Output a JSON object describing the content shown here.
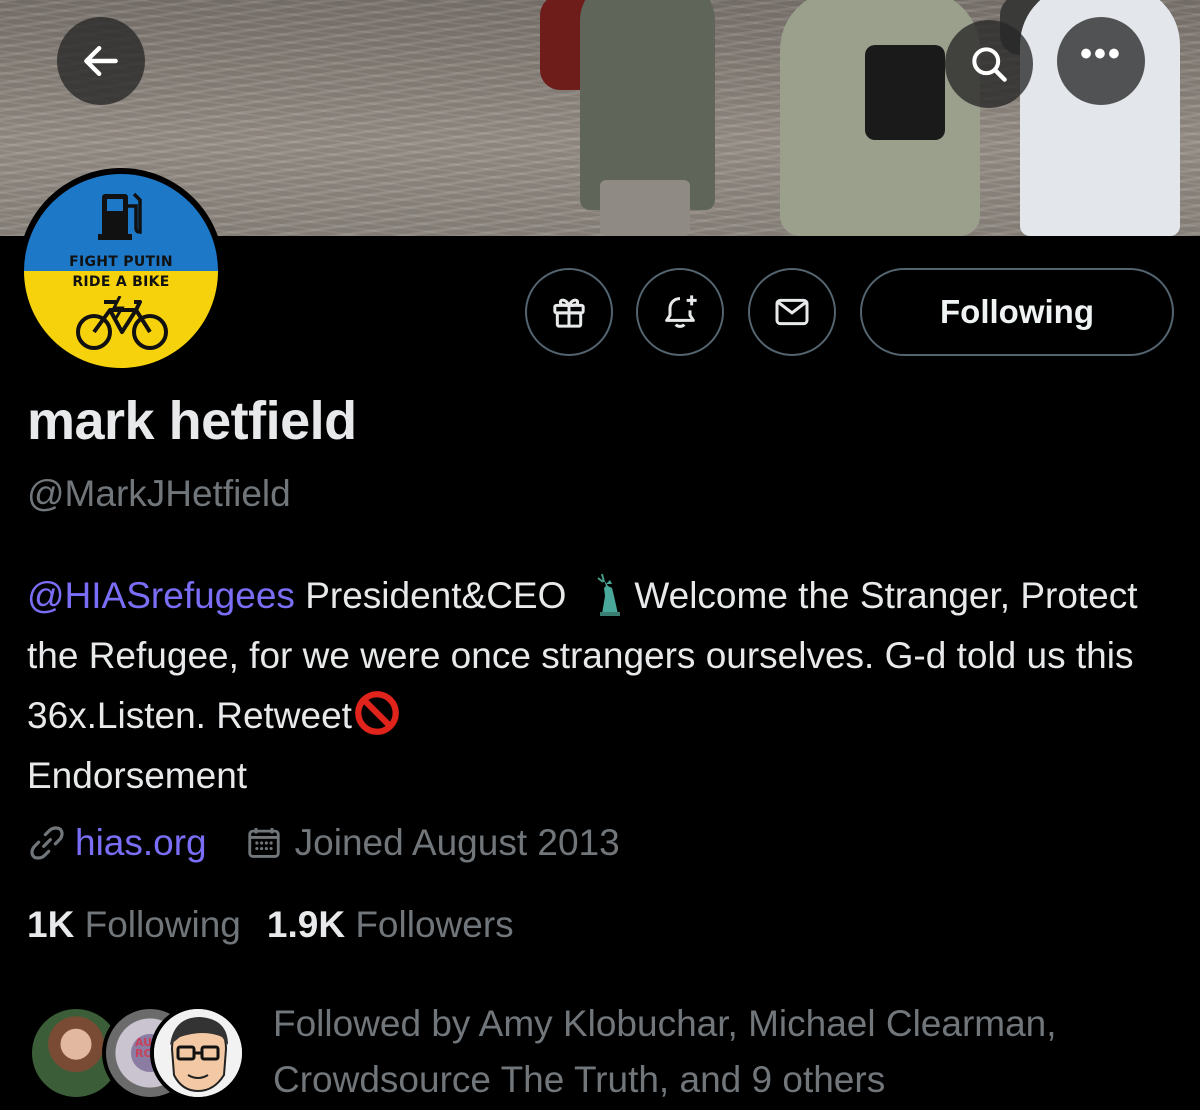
{
  "header": {
    "back_icon": "arrow-left-icon",
    "search_icon": "search-icon",
    "more_icon": "more-horizontal-icon",
    "more_glyph": "•••"
  },
  "avatar": {
    "line1": "FIGHT PUTIN",
    "line2": "RIDE A BIKE",
    "colors": {
      "top": "#1e78c8",
      "bottom": "#f5d20c"
    }
  },
  "actions": {
    "gift_icon": "gift-icon",
    "notify_icon": "bell-plus-icon",
    "message_icon": "mail-icon",
    "follow_label": "Following"
  },
  "profile": {
    "name": "mark hetfield",
    "handle": "@MarkJHetfield",
    "bio": {
      "mention": "@HIASrefugees",
      "part1": " President&CEO",
      "part2": "Welcome the Stranger, Protect the Refugee, for we were once strangers ourselves. G-d told us this 36x.Listen. Retweet",
      "part3": "Endorsement"
    },
    "website": "hias.org",
    "joined": "Joined August 2013"
  },
  "stats": {
    "following_count": "1K",
    "following_label": "Following",
    "followers_count": "1.9K",
    "followers_label": "Followers"
  },
  "followed_by": {
    "text": "Followed by Amy Klobuchar, Michael Clearman, Crowdsource The Truth, and 9 others",
    "avatar2_label": "AUSTIN ROCKS"
  },
  "colors": {
    "accent": "#7b6ef6",
    "muted": "#71767b",
    "text": "#e7e9ea",
    "border": "#536471"
  }
}
